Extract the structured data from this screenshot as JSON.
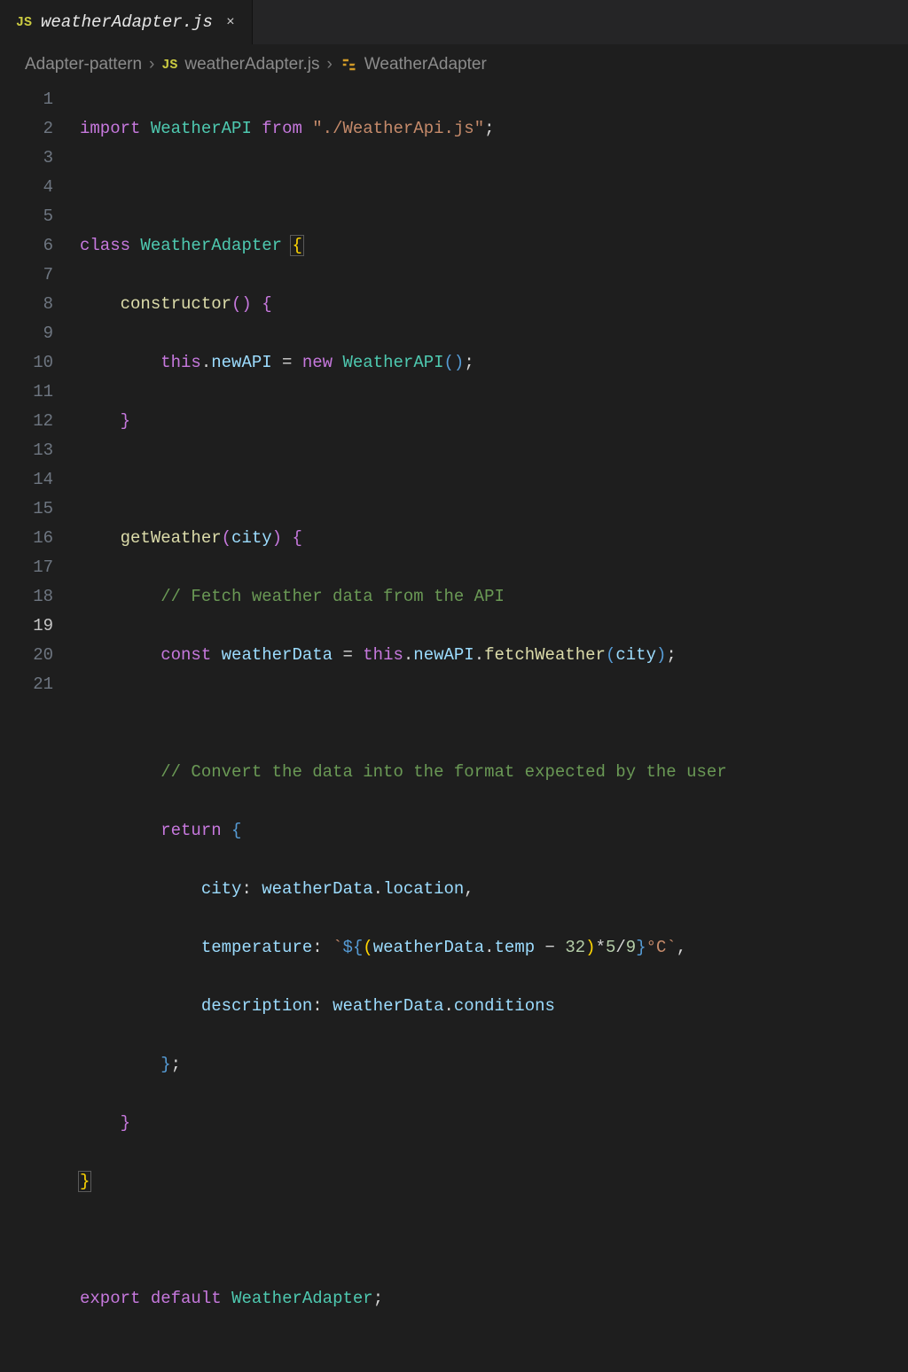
{
  "tab": {
    "icon_label": "JS",
    "title": "weatherAdapter.js",
    "close_glyph": "×"
  },
  "breadcrumb": {
    "item1": "Adapter-pattern",
    "sep": "›",
    "js_icon": "JS",
    "item2": "weatherAdapter.js",
    "item3": "WeatherAdapter"
  },
  "line_numbers": [
    "1",
    "2",
    "3",
    "4",
    "5",
    "6",
    "7",
    "8",
    "9",
    "10",
    "11",
    "12",
    "13",
    "14",
    "15",
    "16",
    "17",
    "18",
    "19",
    "20",
    "21"
  ],
  "active_line_index": 18,
  "code": {
    "l1": {
      "import": "import",
      "WeatherAPI": "WeatherAPI",
      "from": "from",
      "path": "\"./WeatherApi.js\"",
      "semi": ";"
    },
    "l3": {
      "class": "class",
      "name": "WeatherAdapter",
      "brace": "{"
    },
    "l4": {
      "constructor": "constructor",
      "parens": "()",
      "brace": "{"
    },
    "l5": {
      "this": "this",
      "dot": ".",
      "newAPI": "newAPI",
      "eq": " = ",
      "new": "new",
      "cls": "WeatherAPI",
      "parens": "()",
      "semi": ";"
    },
    "l6": {
      "brace": "}"
    },
    "l8": {
      "fn": "getWeather",
      "open": "(",
      "param": "city",
      "close": ")",
      "brace": "{"
    },
    "l9": {
      "cmt": "// Fetch weather data from the API"
    },
    "l10": {
      "const": "const",
      "wd": "weatherData",
      "eq": " = ",
      "this": "this",
      "dot1": ".",
      "newAPI": "newAPI",
      "dot2": ".",
      "fetch": "fetchWeather",
      "open": "(",
      "arg": "city",
      "close": ")",
      "semi": ";"
    },
    "l12": {
      "cmt": "// Convert the data into the format expected by the user"
    },
    "l13": {
      "return": "return",
      "brace": "{"
    },
    "l14": {
      "k": "city",
      "colon": ": ",
      "v1": "weatherData",
      "dot": ".",
      "v2": "location",
      "comma": ","
    },
    "l15": {
      "k": "temperature",
      "colon": ": ",
      "bt1": "`",
      "d1": "${",
      "open": "(",
      "v1": "weatherData",
      "dot": ".",
      "v2": "temp",
      "minus": " − ",
      "n32": "32",
      "close": ")",
      "mul": "*",
      "n5": "5",
      "div": "/",
      "n9": "9",
      "d2": "}",
      "suffix": "°C",
      "bt2": "`",
      "comma": ","
    },
    "l16": {
      "k": "description",
      "colon": ": ",
      "v1": "weatherData",
      "dot": ".",
      "v2": "conditions"
    },
    "l17": {
      "brace": "}",
      "semi": ";"
    },
    "l18": {
      "brace": "}"
    },
    "l19": {
      "brace": "}"
    },
    "l21": {
      "export": "export",
      "default": "default",
      "name": "WeatherAdapter",
      "semi": ";"
    }
  },
  "colors": {
    "keyword": "#c678dd",
    "class": "#4ec9b0",
    "string": "#c58a6a",
    "function": "#dcdcaa",
    "property": "#9cdcfe",
    "comment": "#6a9955",
    "number": "#b5cea8",
    "brace": "#ffd602"
  }
}
